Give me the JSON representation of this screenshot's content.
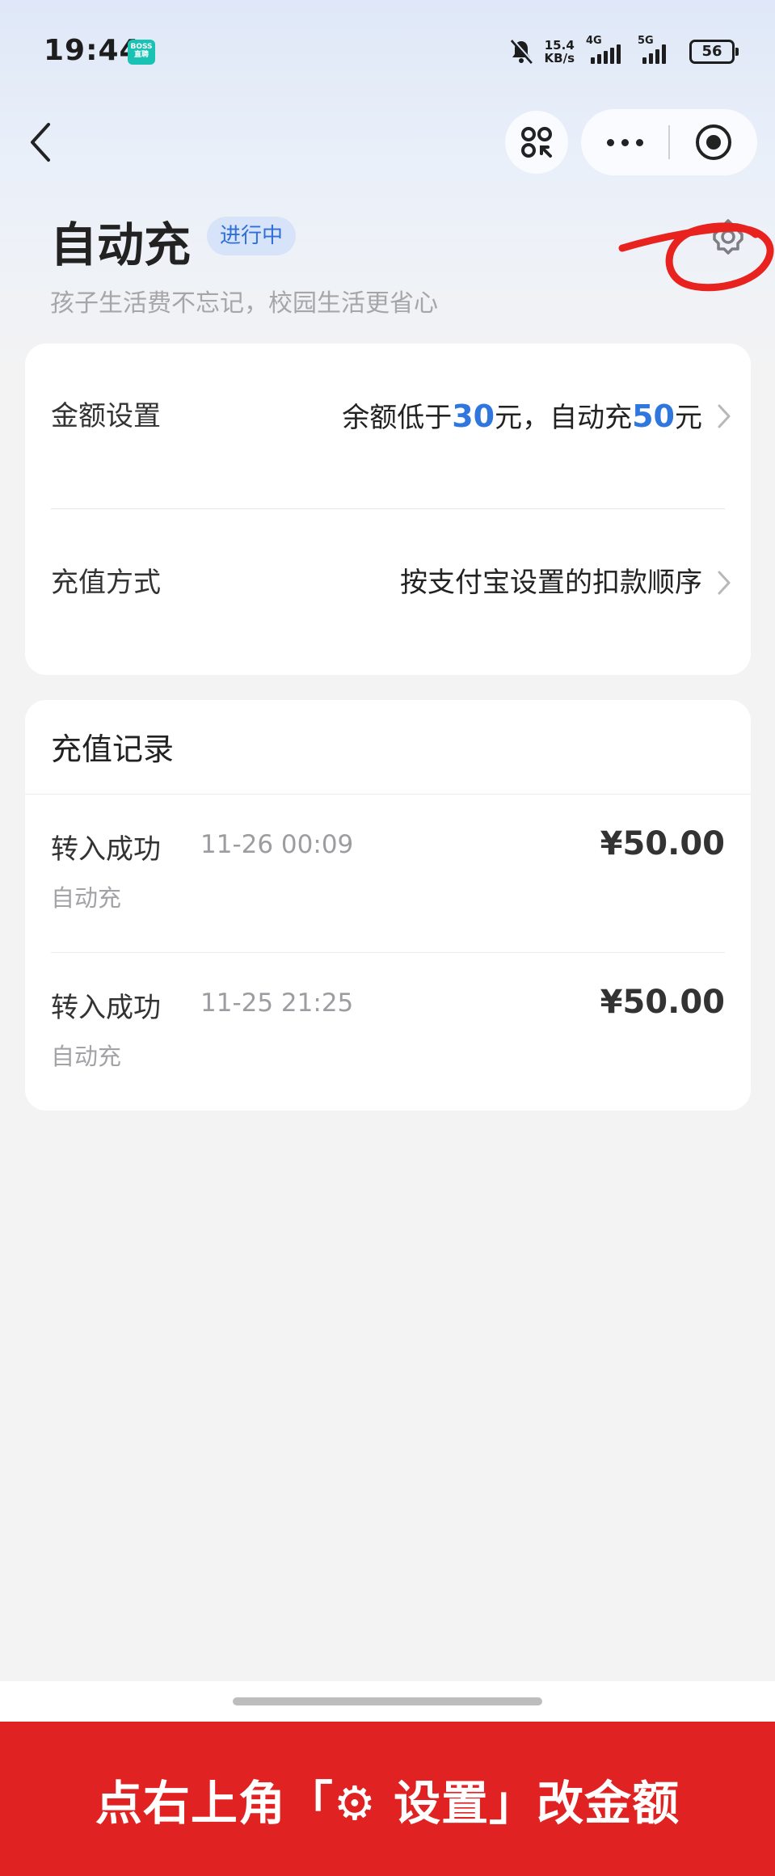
{
  "status_bar": {
    "time": "19:44",
    "app_badge": "BOSS\n直聘",
    "net_speed_value": "15.4",
    "net_speed_unit": "KB/s",
    "signal1_label": "4G",
    "signal2_label": "5G",
    "battery": "56"
  },
  "nav": {
    "back_icon": "chevron-left-icon",
    "scan_icon": "scan-icon",
    "more_icon": "more-dots-icon",
    "close_icon": "target-close-icon"
  },
  "header": {
    "title": "自动充",
    "status_badge": "进行中",
    "subtitle": "孩子生活费不忘记，校园生活更省心",
    "settings_icon": "gear-icon"
  },
  "settings": {
    "amount_label": "金额设置",
    "amount_value": {
      "prefix": "余额低于",
      "threshold": "30",
      "middle": "元，自动充",
      "recharge": "50",
      "suffix": "元"
    },
    "method_label": "充值方式",
    "method_value": "按支付宝设置的扣款顺序"
  },
  "records": {
    "title": "充值记录",
    "items": [
      {
        "status": "转入成功",
        "time": "11-26 00:09",
        "type": "自动充",
        "amount": "¥50.00"
      },
      {
        "status": "转入成功",
        "time": "11-25 21:25",
        "type": "自动充",
        "amount": "¥50.00"
      }
    ]
  },
  "banner": {
    "text": "点右上角「⚙ 设置」改金额"
  },
  "colors": {
    "accent_blue": "#2f77dd",
    "badge_bg": "#d7e3f8",
    "banner_red": "#e02222",
    "annotation_red": "#e8231f"
  }
}
